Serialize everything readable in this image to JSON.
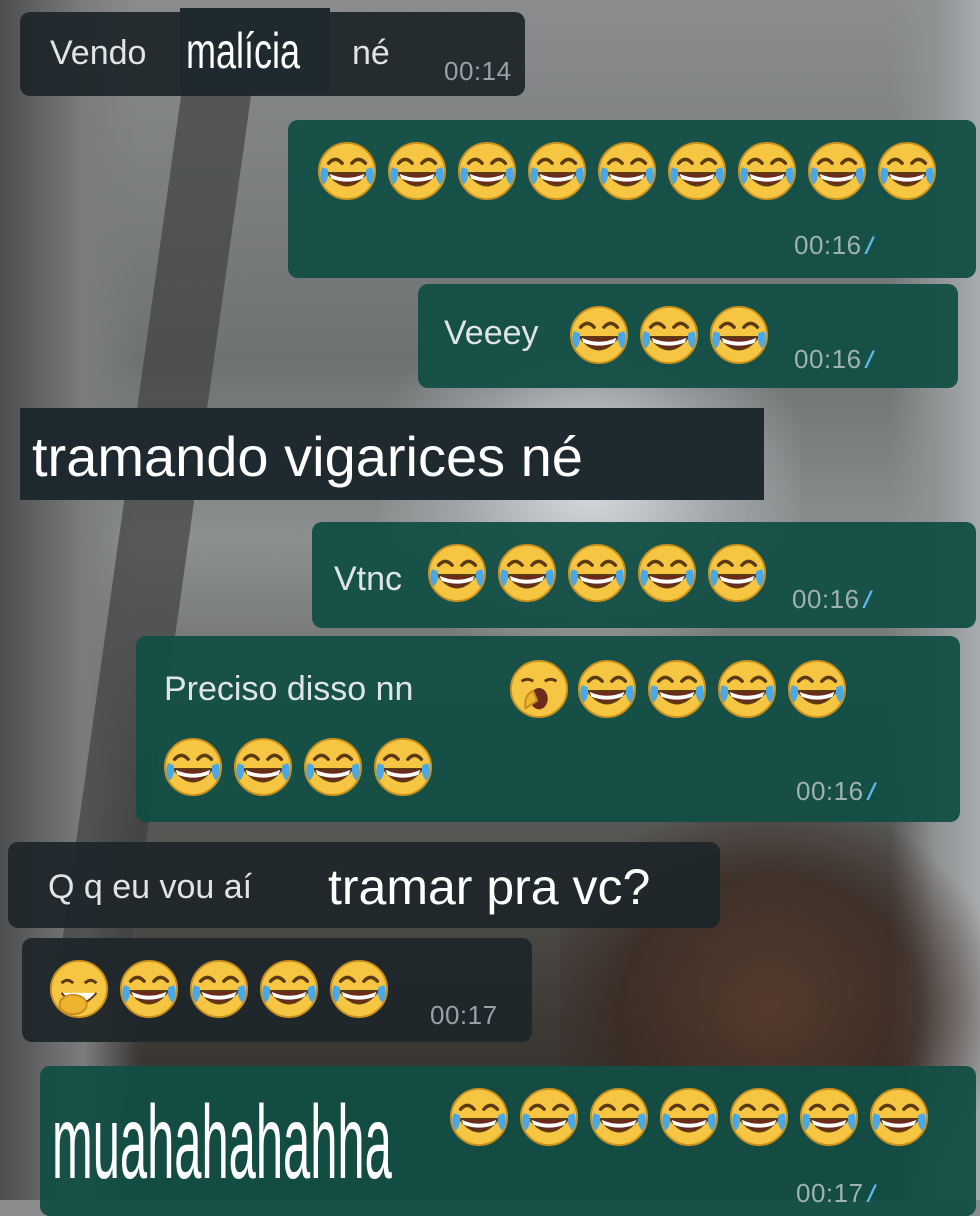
{
  "messages": [
    {
      "id": "m1",
      "text_a": "Vendo",
      "text_b": "né",
      "time": "00:14"
    },
    {
      "id": "m2",
      "emoji_count": 9,
      "time": "00:16",
      "ticks": "//"
    },
    {
      "id": "m3",
      "text": "Veeey",
      "emoji_count": 3,
      "time": "00:16",
      "ticks": "//"
    },
    {
      "id": "m4",
      "text": "Vtnc",
      "emoji_count": 5,
      "time": "00:16",
      "ticks": "//"
    },
    {
      "id": "m5",
      "text": "Preciso disso nn",
      "emoji_count_line1": 4,
      "emoji_count_line2": 4,
      "time": "00:16",
      "ticks": "//"
    },
    {
      "id": "m6",
      "text": "Q q eu vou aí",
      "time": ""
    },
    {
      "id": "m7",
      "emoji_count": 5,
      "time": "00:17"
    },
    {
      "id": "m8",
      "emoji_count": 7,
      "time": "00:17",
      "ticks": "//"
    }
  ],
  "captions": {
    "malicia": "malícia",
    "tramando": "tramando vigarices né",
    "tramar": "tramar pra vc?",
    "muahaha": "muahahahahha"
  },
  "icons": {
    "laugh": "face-with-tears-of-joy-icon",
    "yawn": "yawning-face-icon",
    "hand_over_mouth": "face-with-hand-over-mouth-icon"
  },
  "colors": {
    "incoming_bubble": "#1e262a",
    "outgoing_bubble": "#124e44",
    "read_ticks": "#5fb8e8",
    "caption_box": "#1f2a30"
  }
}
